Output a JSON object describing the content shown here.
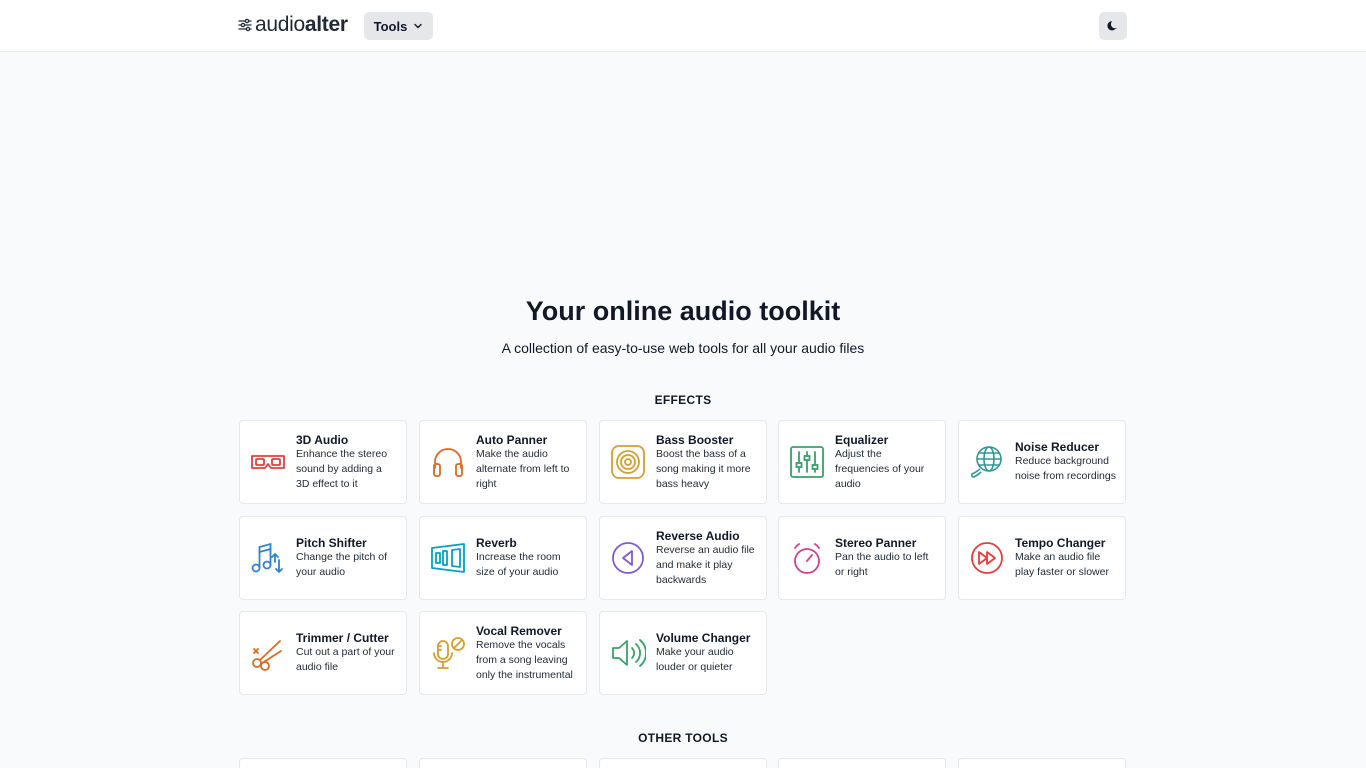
{
  "header": {
    "logo_regular": "audio",
    "logo_bold": "alter",
    "tools_label": "Tools",
    "theme_toggle_icon": "moon-icon"
  },
  "hero": {
    "title": "Your online audio toolkit",
    "subtitle": "A collection of easy-to-use web tools for all your audio files"
  },
  "sections": {
    "effects_heading": "EFFECTS",
    "other_heading": "OTHER TOOLS"
  },
  "effects": [
    {
      "title": "3D Audio",
      "desc": "Enhance the stereo sound by adding a 3D effect to it",
      "icon": "3d-glasses-icon",
      "color": "#e53e3e"
    },
    {
      "title": "Auto Panner",
      "desc": "Make the audio alternate from left to right",
      "icon": "headphones-icon",
      "color": "#dd6b20"
    },
    {
      "title": "Bass Booster",
      "desc": "Boost the bass of a song making it more bass heavy",
      "icon": "speaker-icon",
      "color": "#d69e2e"
    },
    {
      "title": "Equalizer",
      "desc": "Adjust the frequencies of your audio",
      "icon": "equalizer-icon",
      "color": "#38a169"
    },
    {
      "title": "Noise Reducer",
      "desc": "Reduce background noise from recordings",
      "icon": "globe-icon",
      "color": "#319795"
    },
    {
      "title": "Pitch Shifter",
      "desc": "Change the pitch of your audio",
      "icon": "music-note-icon",
      "color": "#3182ce"
    },
    {
      "title": "Reverb",
      "desc": "Increase the room size of your audio",
      "icon": "room-icon",
      "color": "#00a3c4"
    },
    {
      "title": "Reverse Audio",
      "desc": "Reverse an audio file and make it play backwards",
      "icon": "reverse-icon",
      "color": "#805ad5"
    },
    {
      "title": "Stereo Panner",
      "desc": "Pan the audio to left or right",
      "icon": "pan-knob-icon",
      "color": "#d53f8c"
    },
    {
      "title": "Tempo Changer",
      "desc": "Make an audio file play faster or slower",
      "icon": "fast-forward-icon",
      "color": "#e53e3e"
    },
    {
      "title": "Trimmer / Cutter",
      "desc": "Cut out a part of your audio file",
      "icon": "scissors-icon",
      "color": "#dd6b20"
    },
    {
      "title": "Vocal Remover",
      "desc": "Remove the vocals from a song leaving only the instrumental",
      "icon": "microphone-off-icon",
      "color": "#d69e2e"
    },
    {
      "title": "Volume Changer",
      "desc": "Make your audio louder or quieter",
      "icon": "volume-icon",
      "color": "#38a169"
    }
  ]
}
